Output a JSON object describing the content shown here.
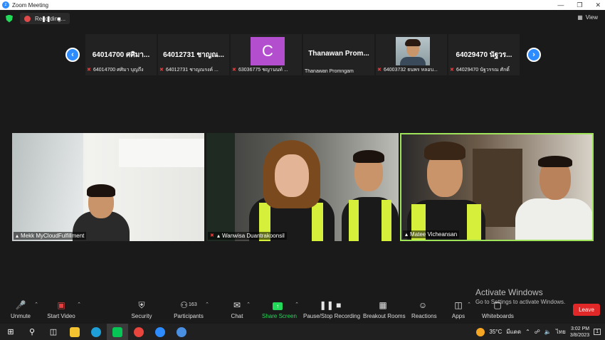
{
  "window": {
    "title": "Zoom Meeting"
  },
  "topbar": {
    "recording_label": "Recording...",
    "view_label": "View"
  },
  "thumbnails": [
    {
      "display": "64014700 ศศิมา...",
      "label": "64014700 ศศิมา บุญถึง",
      "type": "name"
    },
    {
      "display": "64012731 ชาญณ...",
      "label": "64012731 ชาญณรงค์ ...",
      "type": "name"
    },
    {
      "display": "C",
      "label": "63036775 ชญานนท์ ...",
      "type": "avatar"
    },
    {
      "display": "Thanawan Prom...",
      "label": "Thanawan Promngam",
      "type": "name"
    },
    {
      "display": "",
      "label": "64003732 ธนพร หลอบ...",
      "type": "camera"
    },
    {
      "display": "64029470 นัฐวร...",
      "label": "64029470 นัฐวรรณ ศักดิ์",
      "type": "name"
    }
  ],
  "videos": [
    {
      "name": "Mekk MyCloudFulfillment"
    },
    {
      "name": "Wanwisa Duantrakoonsil"
    },
    {
      "name": "Matee Vicheansan"
    }
  ],
  "watermark": {
    "line1": "Activate Windows",
    "line2": "Go to Settings to activate Windows."
  },
  "toolbar": {
    "unmute": "Unmute",
    "start_video": "Start Video",
    "security": "Security",
    "participants": "Participants",
    "participants_count": "163",
    "chat": "Chat",
    "share_screen": "Share Screen",
    "pause_recording": "Pause/Stop Recording",
    "breakout_rooms": "Breakout Rooms",
    "reactions": "Reactions",
    "apps": "Apps",
    "whiteboards": "Whiteboards",
    "leave": "Leave"
  },
  "taskbar": {
    "temperature": "35°C",
    "weather": "มีแดด",
    "language": "ไทย",
    "time": "3:02 PM",
    "date": "3/8/2023",
    "notifications": "1"
  },
  "colors": {
    "accent": "#2d8cff",
    "leave": "#e02828",
    "share": "#23d959",
    "active_speaker": "#9ee35a"
  }
}
